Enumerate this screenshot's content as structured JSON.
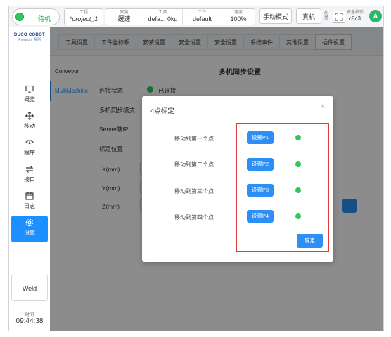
{
  "topbar": {
    "status": "待机",
    "project_label": "工程",
    "project_value": "*project_1",
    "safety_label": "安装",
    "safety_value": "缓速",
    "tool_label": "工具",
    "tool_value": "defa... 0kg",
    "workpiece_label": "工件",
    "workpiece_value": "default",
    "speed_label": "速度",
    "speed_value": "100%",
    "mode_button": "手动模式",
    "real_button": "真机",
    "enable_label": "能量",
    "safety_checksum_label": "安全校验",
    "safety_checksum_value": "c8c3",
    "avatar": "A"
  },
  "sidebar": {
    "logo_line1": "DUCO COBOT",
    "logo_line2": "Premium 系列",
    "items": [
      {
        "label": "概览",
        "icon": "monitor-icon"
      },
      {
        "label": "移动",
        "icon": "move-icon"
      },
      {
        "label": "程序",
        "icon": "code-icon"
      },
      {
        "label": "接口",
        "icon": "swap-icon"
      },
      {
        "label": "日志",
        "icon": "calendar-icon"
      },
      {
        "label": "设置",
        "icon": "gear-icon"
      }
    ],
    "weld_button": "Weld",
    "clock_label": "时间",
    "clock_value": "09:44:38"
  },
  "tabs": [
    "工具设置",
    "工件坐标系",
    "安装设置",
    "安全设置",
    "安全设置",
    "系统事件",
    "其他设置",
    "插件设置"
  ],
  "plugins": [
    "Conveyor",
    "MultiMachine"
  ],
  "page": {
    "title": "多机同步设置",
    "conn_label": "连接状态",
    "conn_value": "已连接",
    "sync_mode_label": "多机同步模式",
    "server_ip_label": "Server端IP",
    "calib_label": "标定位置",
    "x_label": "X(mm)",
    "y_label": "Y(mm)",
    "z_label": "Z(mm)"
  },
  "modal": {
    "title": "4点标定",
    "close": "×",
    "steps": [
      {
        "label": "移动到第一个点",
        "button": "设置P1"
      },
      {
        "label": "移动到第二个点",
        "button": "设置P2"
      },
      {
        "label": "移动到第三个点",
        "button": "设置P3"
      },
      {
        "label": "移动到第四个点",
        "button": "设置P4"
      }
    ],
    "confirm": "确定"
  },
  "colors": {
    "accent": "#2b8ff5",
    "status_ok": "#2ec95a",
    "highlight_box": "#e23b3b",
    "nav_active": "#1e8fff"
  }
}
